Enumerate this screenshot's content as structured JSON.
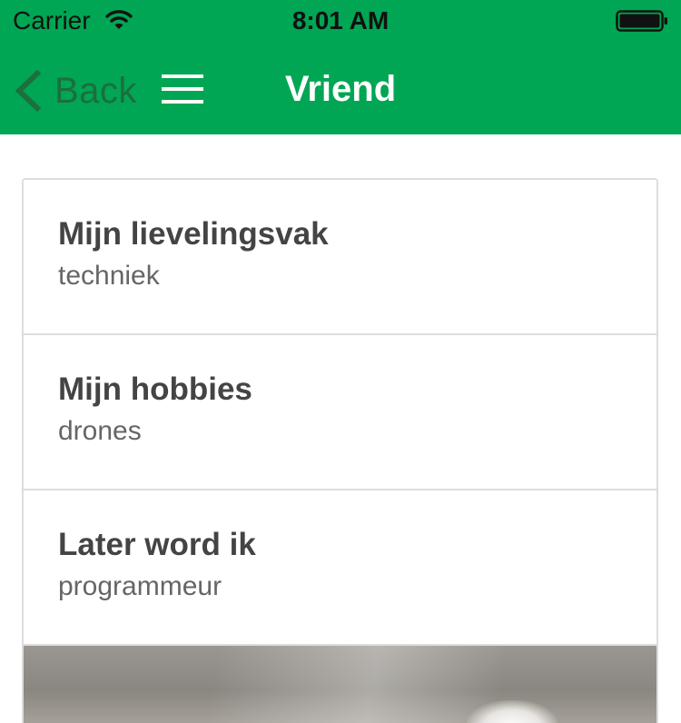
{
  "status_bar": {
    "carrier": "Carrier",
    "time": "8:01 AM",
    "icons": [
      "wifi-icon",
      "battery-icon"
    ]
  },
  "nav": {
    "back_label": "Back",
    "title": "Vriend",
    "icons": [
      "chevron-left-icon",
      "hamburger-menu-icon"
    ]
  },
  "profile": {
    "items": [
      {
        "title": "Mijn lievelingsvak",
        "value": "techniek"
      },
      {
        "title": "Mijn hobbies",
        "value": "drones"
      },
      {
        "title": "Later word ik",
        "value": "programmeur"
      }
    ]
  },
  "colors": {
    "header_green": "#00a653",
    "back_label": "#1f6a3a",
    "item_title": "#444444",
    "item_value": "#666666",
    "divider": "#dddddd"
  }
}
